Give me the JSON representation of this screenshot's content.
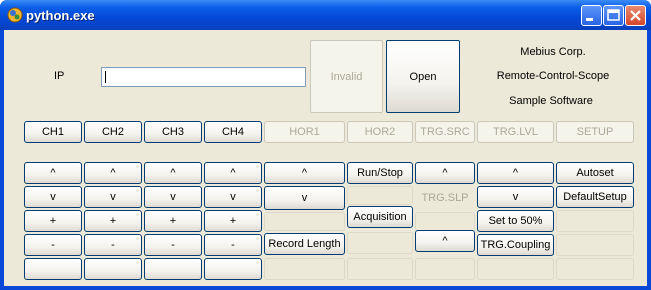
{
  "window": {
    "title": "python.exe",
    "icon": "python-icon"
  },
  "connection": {
    "ip_label": "IP",
    "ip_value": "",
    "invalid_label": "Invalid",
    "open_label": "Open"
  },
  "info": {
    "line1": "Mebius Corp.",
    "line2": "Remote-Control-Scope",
    "line3": "Sample Software"
  },
  "tabs": {
    "ch1": "CH1",
    "ch2": "CH2",
    "ch3": "CH3",
    "ch4": "CH4",
    "hor1": "HOR1",
    "hor2": "HOR2",
    "trg_src": "TRG.SRC",
    "trg_lvl": "TRG.LVL",
    "setup": "SETUP"
  },
  "controls": {
    "up": "^",
    "down": "v",
    "plus": "+",
    "minus": "-",
    "run_stop": "Run/Stop",
    "acquisition": "Acquisition",
    "record_length": "Record Length",
    "trg_slp": "TRG.SLP",
    "set_50": "Set to 50%",
    "trg_coupling": "TRG.Coupling",
    "autoset": "Autoset",
    "default_setup": "DefaultSetup"
  },
  "colors": {
    "title_bar": "#0a5ee8",
    "client_bg": "#ece9d8",
    "button_border": "#003c74"
  }
}
